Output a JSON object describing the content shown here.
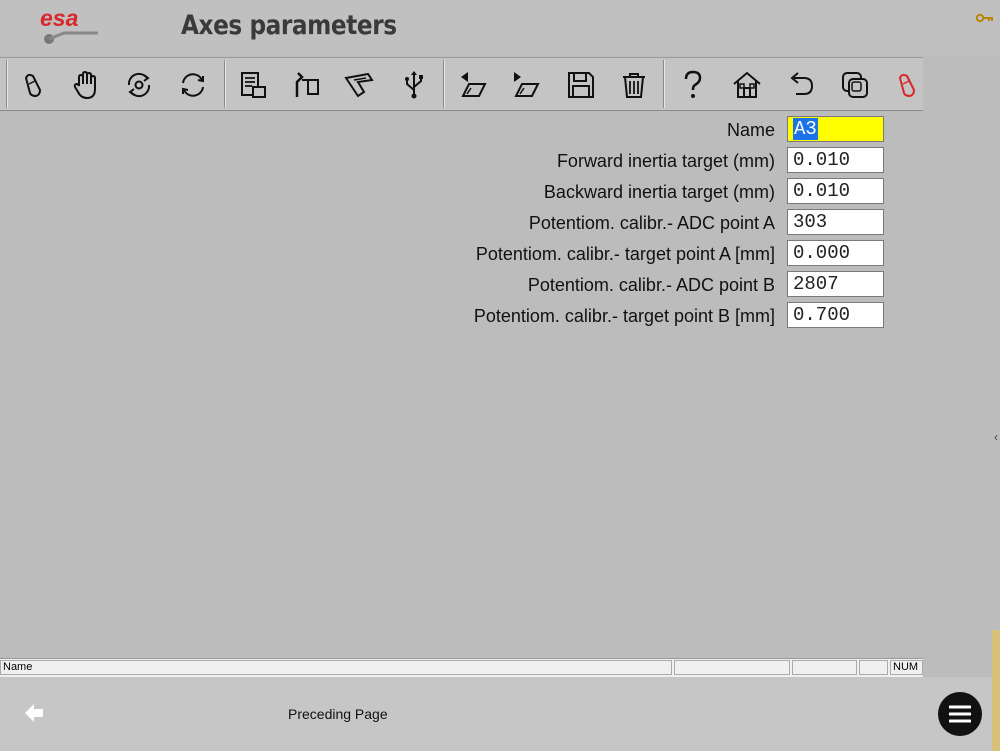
{
  "header": {
    "logo_text": "esa",
    "title": "Axes parameters"
  },
  "toolbar": {
    "buttons": [
      {
        "name": "pen-tool-icon"
      },
      {
        "name": "hand-icon"
      },
      {
        "name": "rotate-settings-icon"
      },
      {
        "name": "refresh-icon"
      },
      {
        "name": "document-list-icon"
      },
      {
        "name": "tools-icon"
      },
      {
        "name": "press-tool-icon"
      },
      {
        "name": "usb-icon"
      },
      {
        "name": "previous-icon"
      },
      {
        "name": "next-icon"
      },
      {
        "name": "save-icon"
      },
      {
        "name": "delete-icon"
      },
      {
        "name": "help-icon"
      },
      {
        "name": "home-icon"
      },
      {
        "name": "undo-icon"
      },
      {
        "name": "copy-icon"
      },
      {
        "name": "red-tool-icon"
      }
    ]
  },
  "form": {
    "rows": [
      {
        "label": "Name",
        "value": "A3"
      },
      {
        "label": "Forward inertia target (mm)",
        "value": "0.010"
      },
      {
        "label": "Backward inertia target (mm)",
        "value": "0.010"
      },
      {
        "label": "Potentiom. calibr.- ADC point A",
        "value": "303"
      },
      {
        "label": "Potentiom. calibr.- target point A [mm]",
        "value": "0.000"
      },
      {
        "label": "Potentiom. calibr.- ADC point B",
        "value": "2807"
      },
      {
        "label": "Potentiom. calibr.- target point B [mm]",
        "value": "0.700"
      }
    ]
  },
  "statusbar": {
    "field_name": "Name",
    "num_indicator": "NUM"
  },
  "bottom": {
    "prev_label": "Preceding Page"
  },
  "colors": {
    "background": "#bcbcbc",
    "active_field": "#ffff00",
    "selection": "#1a73e8",
    "logo_red": "#d9262c"
  }
}
